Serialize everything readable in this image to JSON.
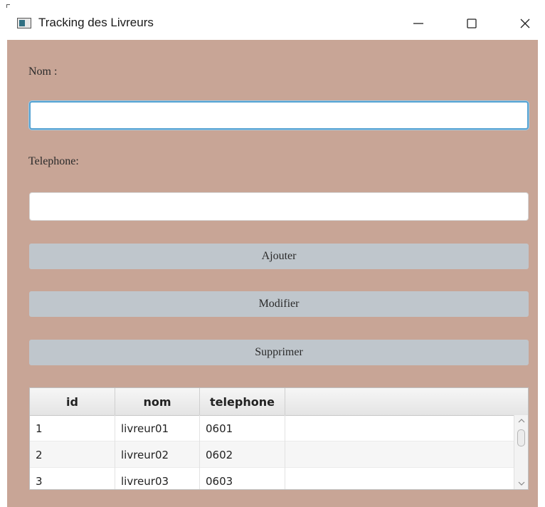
{
  "window": {
    "title": "Tracking des Livreurs",
    "controls": {
      "minimize": "—",
      "maximize": "☐",
      "close": "✕"
    }
  },
  "colors": {
    "background": "#c8a596",
    "button": "#bfc6cc",
    "focus": "#57a3d2"
  },
  "form": {
    "nom_label": "Nom :",
    "nom_value": "",
    "telephone_label": "Telephone:",
    "telephone_value": ""
  },
  "buttons": {
    "add": "Ajouter",
    "edit": "Modifier",
    "delete": "Supprimer"
  },
  "table": {
    "columns": [
      "id",
      "nom",
      "telephone"
    ],
    "rows": [
      [
        "1",
        "livreur01",
        "0601"
      ],
      [
        "2",
        "livreur02",
        "0602"
      ],
      [
        "3",
        "livreur03",
        "0603"
      ]
    ]
  }
}
